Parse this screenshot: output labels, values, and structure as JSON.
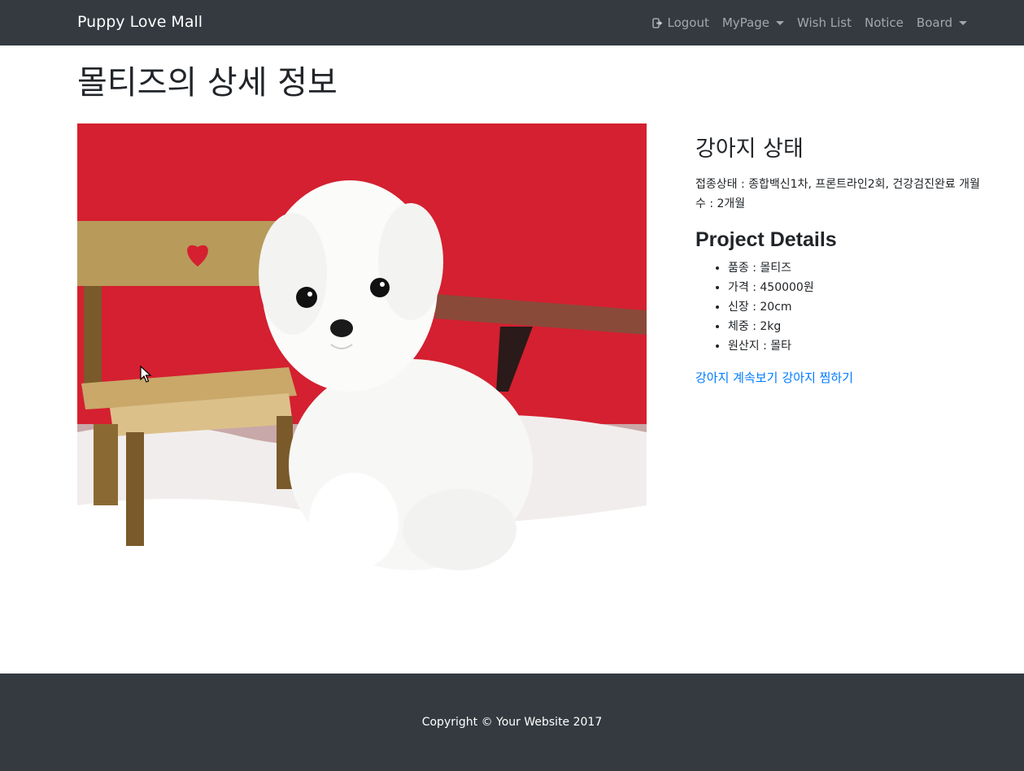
{
  "navbar": {
    "brand": "Puppy Love Mall",
    "items": [
      {
        "label": "Logout",
        "icon": "logout-icon"
      },
      {
        "label": "MyPage",
        "dropdown": true
      },
      {
        "label": "Wish List"
      },
      {
        "label": "Notice"
      },
      {
        "label": "Board",
        "dropdown": true
      }
    ]
  },
  "page": {
    "title": "몰티즈의 상세 정보"
  },
  "status": {
    "heading": "강아지 상태",
    "vaccination": "접종상태 : 종합백신1차, 프론트라인2회, 건강검진완료 개월수 : 2개월"
  },
  "details": {
    "heading": "Project Details",
    "items": [
      "품종 : 몰티즈",
      "가격 : 450000원",
      "신장 : 20cm",
      "체중 : 2kg",
      "원산지 : 몰타"
    ]
  },
  "links": {
    "continue": "강아지 계속보기",
    "wish": "강아지 찜하기"
  },
  "footer": {
    "copyright": "Copyright © Your Website 2017"
  },
  "colors": {
    "navbar": "#343a40",
    "link": "#007bff",
    "photo_background": "#d42030"
  }
}
